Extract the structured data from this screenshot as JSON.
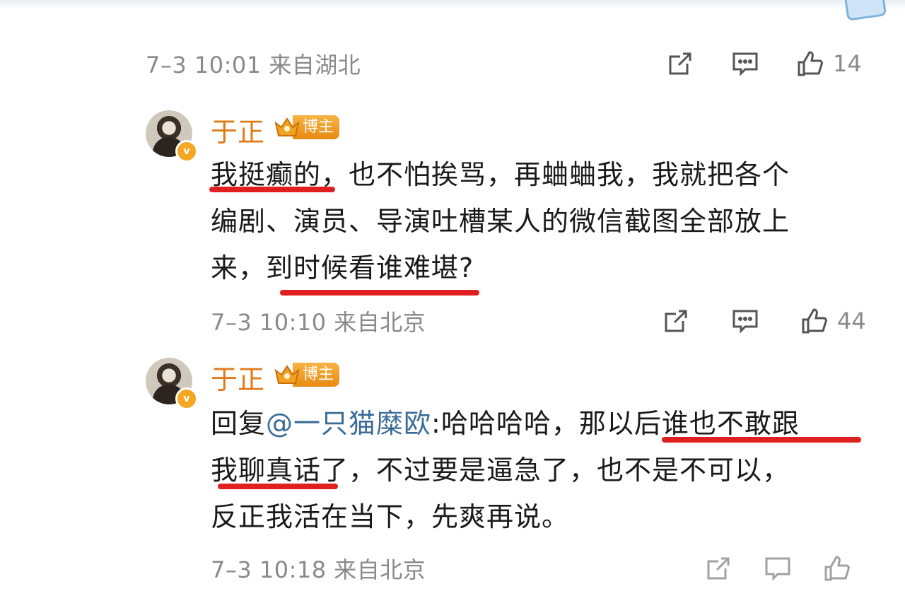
{
  "top": {
    "meta": "7–3 10:01  来自湖北",
    "likes": "14"
  },
  "comments": [
    {
      "username": "于正",
      "badge": "博主",
      "avatar_badge": "v",
      "lines": [
        "我挺癫的，也不怕挨骂，再蛐蛐我，我就把各个",
        "编剧、演员、导演吐槽某人的微信截图全部放上",
        "来，到时候看谁难堪?"
      ],
      "meta": "7–3 10:10  来自北京",
      "likes": "44"
    },
    {
      "username": "于正",
      "badge": "博主",
      "avatar_badge": "v",
      "reply_prefix": "回复",
      "mention": "@一只猫糜欧",
      "line1_rest": ":哈哈哈哈，那以后谁也不敢跟",
      "lines": [
        "我聊真话了，不过要是逼急了，也不是不可以，",
        "反正我活在当下，先爽再说。"
      ],
      "meta": "7–3 10:18  来自北京"
    }
  ],
  "icons": {
    "repost": "repost-icon",
    "comment": "comment-icon",
    "like": "like-icon"
  },
  "colors": {
    "username": "#e07b1a",
    "meta": "#8a8a8a",
    "mention": "#3a6b98",
    "underline": "#e02020"
  }
}
